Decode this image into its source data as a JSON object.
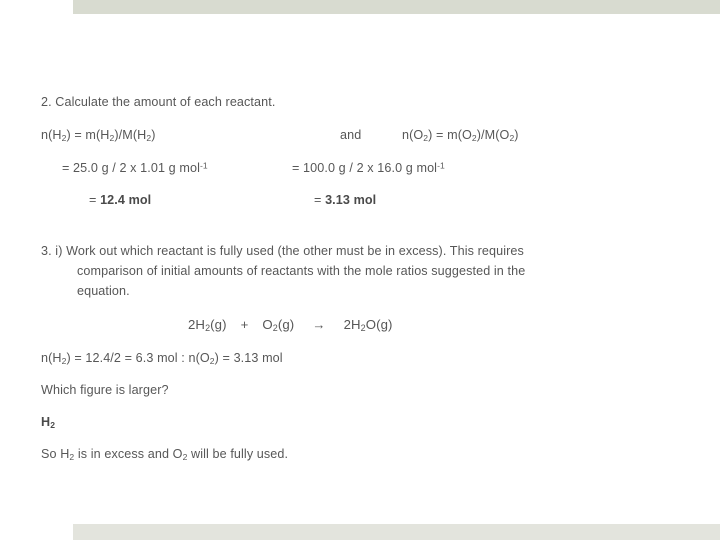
{
  "slide": {
    "theme": {
      "top_bar_color": "#d8dbd0",
      "bottom_bar_color": "#e3e4dd",
      "background_color": "#ffffff",
      "text_color": "#575757"
    },
    "step2": {
      "heading": "2. Calculate the amount of each reactant.",
      "hydrogen_formula": {
        "lhs": "n(H",
        "lhs_sub": "2",
        "mid": ") = m(H",
        "mid_sub": "2",
        "tail": ")/M(H",
        "tail_sub": "2",
        "end": ")"
      },
      "conjunction": "and",
      "oxygen_formula": {
        "lhs": "n(O",
        "lhs_sub": "2",
        "mid": ") = m(O",
        "mid_sub": "2",
        "tail": ")/M(O",
        "tail_sub": "2",
        "end": ")"
      },
      "hydrogen_calculation": {
        "text": "= 25.0 g / 2 x 1.01 g mol",
        "superscript": "-1"
      },
      "oxygen_calculation": {
        "text": "= 100.0 g / 2 x 16.0 g mol",
        "superscript": "-1"
      },
      "hydrogen_result": {
        "equals": "= ",
        "value": "12.4 mol"
      },
      "oxygen_result": {
        "equals": "= ",
        "value": "3.13 mol"
      }
    },
    "step3": {
      "line1": "3. i) Work out which reactant is fully used (the other must be in excess). This requires",
      "line2": "comparison of initial amounts of reactants with the mole ratios suggested in the",
      "line3": "equation.",
      "equation": {
        "reactant1_coefficient": "2H",
        "reactant1_sub": "2",
        "reactant1_state": "(g)",
        "plus": "+",
        "reactant2": "O",
        "reactant2_sub": "2",
        "reactant2_state": "(g)",
        "arrow": "→",
        "product": "2H",
        "product_sub1": "2",
        "product_mid": "O",
        "product_state": "(g)"
      },
      "mole_comparison": {
        "h_label": "n(H",
        "h_sub": "2",
        "h_value": ") = 12.4/2 = 6.3 mol : n(O",
        "o_sub": "2",
        "o_value": ") = 3.13 mol"
      },
      "question": "Which figure is larger?",
      "answer": {
        "text": "H",
        "sub": "2"
      },
      "conclusion": {
        "part1": "So H",
        "sub1": "2",
        "part2": " is in excess and O",
        "sub2": "2",
        "part3": " will be fully used."
      }
    }
  }
}
